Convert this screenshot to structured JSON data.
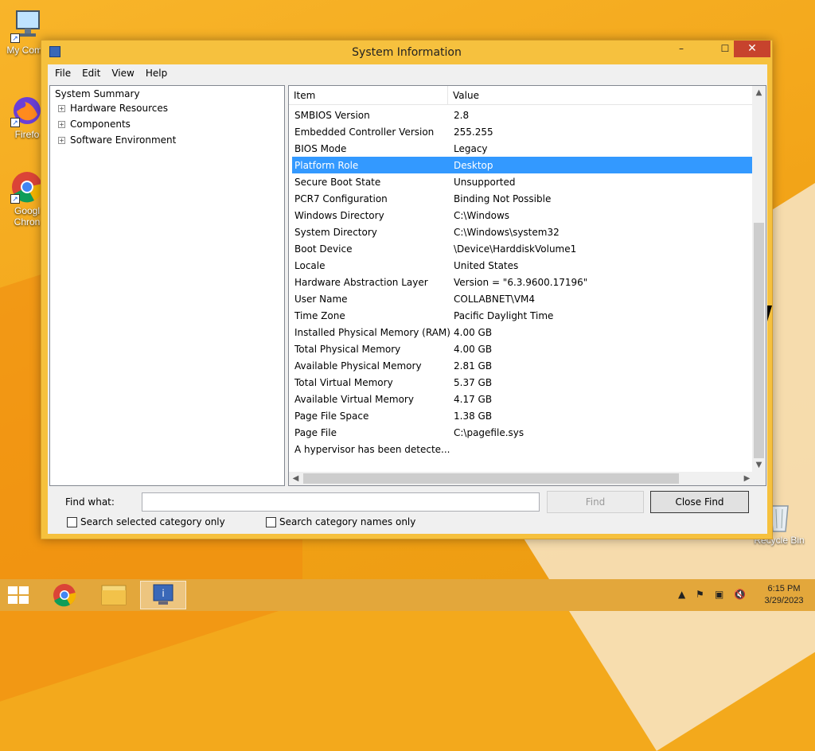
{
  "desktop": {
    "icons": [
      {
        "label": "My Comp",
        "icon": "computer-icon"
      },
      {
        "label": "Firefo",
        "icon": "firefox-icon"
      },
      {
        "label": "Googl",
        "label2": "Chron",
        "icon": "chrome-icon"
      },
      {
        "label": "Recycle Bin",
        "icon": "recycle-bin-icon"
      }
    ]
  },
  "window": {
    "title": "System Information",
    "controls": {
      "minimize": "–",
      "maximize": "☐",
      "close": "✕"
    }
  },
  "menu": [
    "File",
    "Edit",
    "View",
    "Help"
  ],
  "tree": {
    "root": "System Summary",
    "children": [
      {
        "label": "Hardware Resources",
        "expander": "+"
      },
      {
        "label": "Components",
        "expander": "+"
      },
      {
        "label": "Software Environment",
        "expander": "+"
      }
    ]
  },
  "list": {
    "columns": [
      "Item",
      "Value"
    ],
    "rows": [
      {
        "item": "SMBIOS Version",
        "value": "2.8"
      },
      {
        "item": "Embedded Controller Version",
        "value": "255.255"
      },
      {
        "item": "BIOS Mode",
        "value": "Legacy"
      },
      {
        "item": "Platform Role",
        "value": "Desktop",
        "selected": true
      },
      {
        "item": "Secure Boot State",
        "value": "Unsupported"
      },
      {
        "item": "PCR7 Configuration",
        "value": "Binding Not Possible"
      },
      {
        "item": "Windows Directory",
        "value": "C:\\Windows"
      },
      {
        "item": "System Directory",
        "value": "C:\\Windows\\system32"
      },
      {
        "item": "Boot Device",
        "value": "\\Device\\HarddiskVolume1"
      },
      {
        "item": "Locale",
        "value": "United States"
      },
      {
        "item": "Hardware Abstraction Layer",
        "value": "Version = \"6.3.9600.17196\""
      },
      {
        "item": "User Name",
        "value": "COLLABNET\\VM4"
      },
      {
        "item": "Time Zone",
        "value": "Pacific Daylight Time"
      },
      {
        "item": "Installed Physical Memory (RAM)",
        "value": "4.00 GB"
      },
      {
        "item": "Total Physical Memory",
        "value": "4.00 GB"
      },
      {
        "item": "Available Physical Memory",
        "value": "2.81 GB"
      },
      {
        "item": "Total Virtual Memory",
        "value": "5.37 GB"
      },
      {
        "item": "Available Virtual Memory",
        "value": "4.17 GB"
      },
      {
        "item": "Page File Space",
        "value": "1.38 GB"
      },
      {
        "item": "Page File",
        "value": "C:\\pagefile.sys"
      },
      {
        "item": "A hypervisor has been detecte...",
        "value": ""
      }
    ]
  },
  "find": {
    "label": "Find what:",
    "value": "",
    "find_button": "Find",
    "close_find_button": "Close Find",
    "option_selected_category": "Search selected category only",
    "option_category_names": "Search category names only"
  },
  "taskbar": {
    "apps": [
      {
        "name": "chrome-icon"
      },
      {
        "name": "file-explorer-icon"
      },
      {
        "name": "system-information-icon",
        "active": true
      }
    ],
    "clock": {
      "time": "6:15 PM",
      "date": "3/29/2023"
    }
  },
  "colors": {
    "selection": "#3399ff",
    "desktop": "#f3a91c",
    "window_frame": "#f6c13e",
    "close_button": "#c7432d"
  }
}
